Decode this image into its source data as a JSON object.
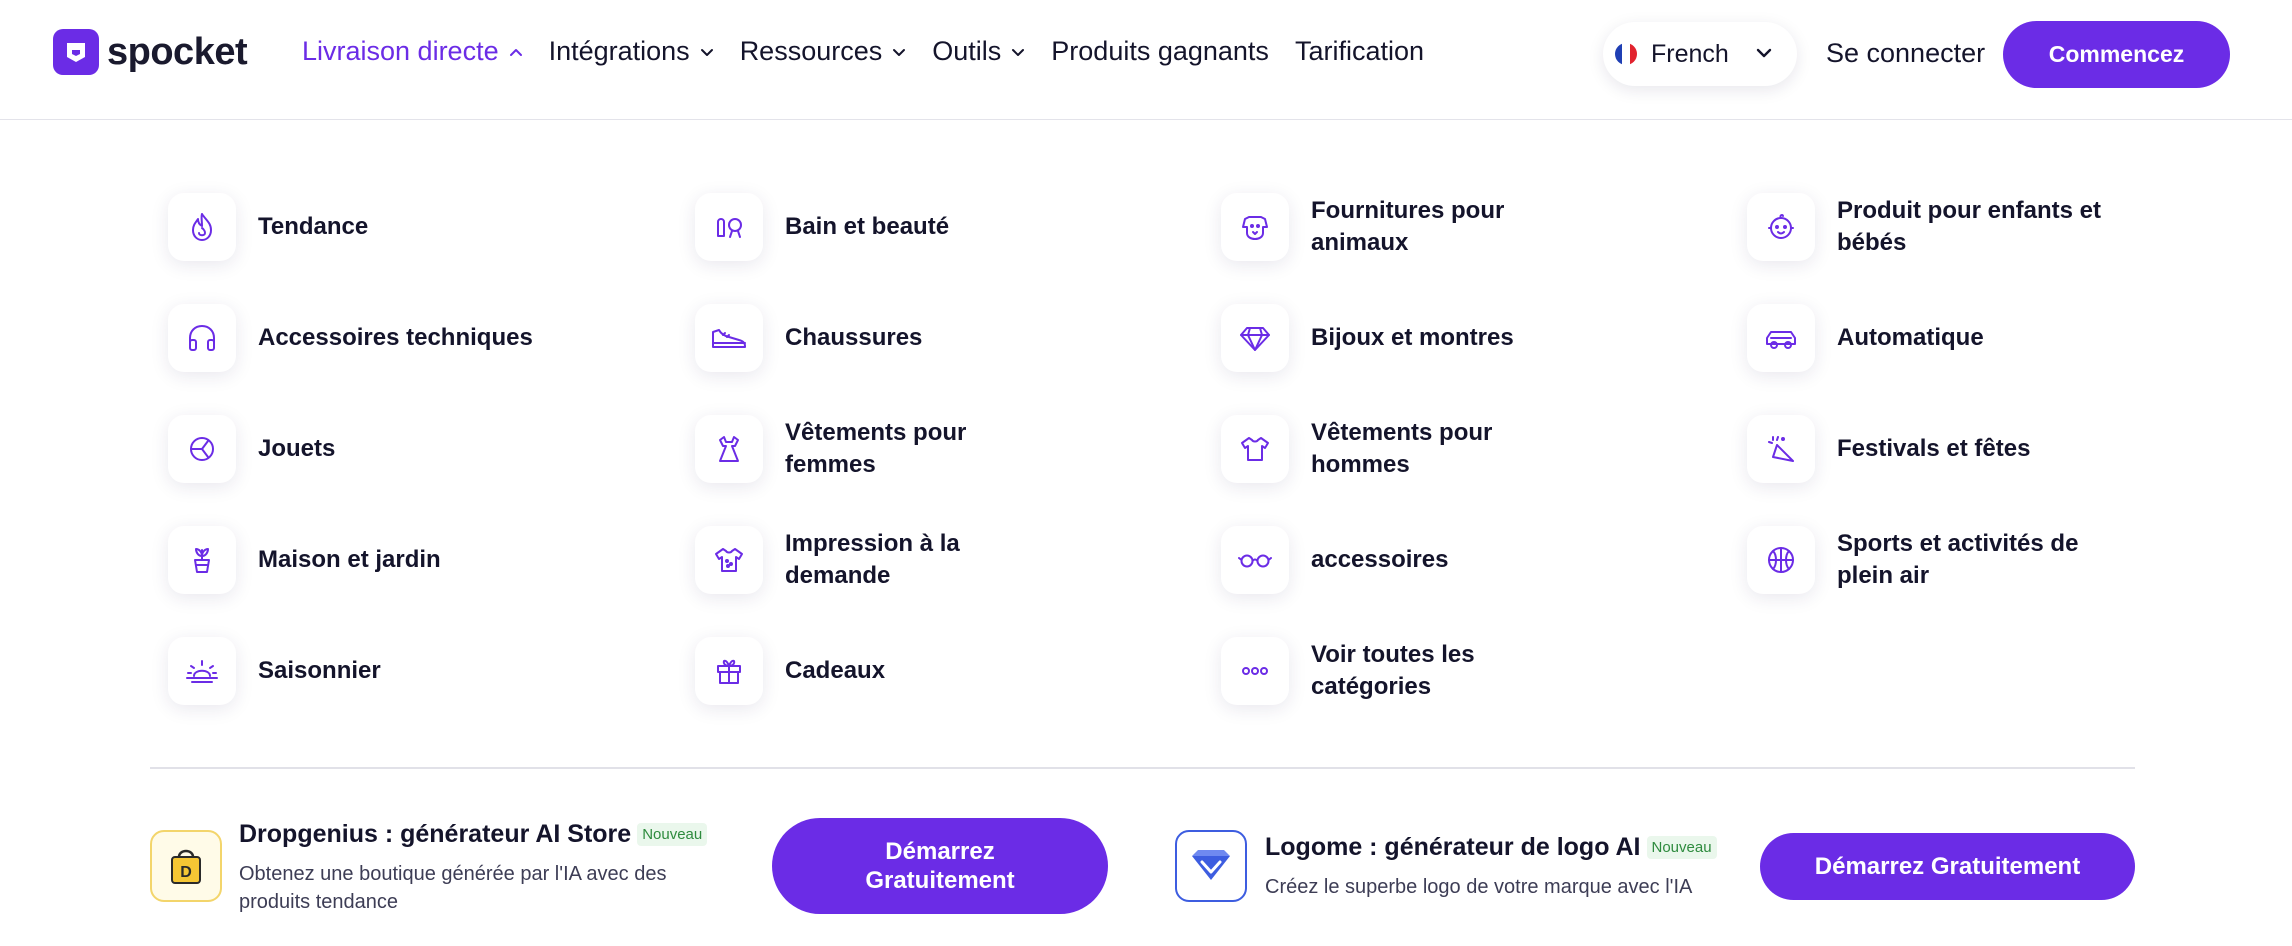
{
  "brand": {
    "name": "spocket",
    "color": "#6b2ce6"
  },
  "nav": {
    "items": [
      {
        "label": "Livraison directe",
        "active": true,
        "dropdown": true
      },
      {
        "label": "Intégrations",
        "dropdown": true
      },
      {
        "label": "Ressources",
        "dropdown": true
      },
      {
        "label": "Outils",
        "dropdown": true
      },
      {
        "label": "Produits gagnants",
        "dropdown": false
      },
      {
        "label": "Tarification",
        "dropdown": false
      }
    ],
    "language": "French",
    "login": "Se connecter",
    "cta": "Commencez"
  },
  "categories": [
    {
      "label": "Tendance",
      "icon": "flame-icon"
    },
    {
      "label": "Bain et beauté",
      "icon": "beauty-icon"
    },
    {
      "label": "Fournitures pour animaux",
      "icon": "dog-icon"
    },
    {
      "label": "Produit pour enfants et bébés",
      "icon": "baby-icon"
    },
    {
      "label": "Accessoires techniques",
      "icon": "headphones-icon"
    },
    {
      "label": "Chaussures",
      "icon": "shoe-icon"
    },
    {
      "label": "Bijoux et montres",
      "icon": "diamond-icon"
    },
    {
      "label": "Automatique",
      "icon": "car-icon"
    },
    {
      "label": "Jouets",
      "icon": "toy-icon"
    },
    {
      "label": "Vêtements pour femmes",
      "icon": "dress-icon"
    },
    {
      "label": "Vêtements pour hommes",
      "icon": "tshirt-icon"
    },
    {
      "label": "Festivals et fêtes",
      "icon": "party-icon"
    },
    {
      "label": "Maison et jardin",
      "icon": "plant-icon"
    },
    {
      "label": "Impression à la demande",
      "icon": "print-shirt-icon"
    },
    {
      "label": "accessoires",
      "icon": "glasses-icon"
    },
    {
      "label": "Sports et activités de plein air",
      "icon": "ball-icon"
    },
    {
      "label": "Saisonnier",
      "icon": "sunrise-icon"
    },
    {
      "label": "Cadeaux",
      "icon": "gift-icon"
    },
    {
      "label": "Voir toutes les catégories",
      "icon": "more-dots-icon"
    }
  ],
  "promos": [
    {
      "title": "Dropgenius : générateur AI Store",
      "badge": "Nouveau",
      "description": "Obtenez une boutique générée par l'IA avec des produits tendance",
      "button": "Démarrez Gratuitement",
      "icon": "dropgenius-bag-icon"
    },
    {
      "title": "Logome : générateur de logo AI",
      "badge": "Nouveau",
      "description": "Créez le superbe logo de votre marque avec l'IA",
      "button": "Démarrez Gratuitement",
      "icon": "logome-diamond-icon"
    }
  ]
}
